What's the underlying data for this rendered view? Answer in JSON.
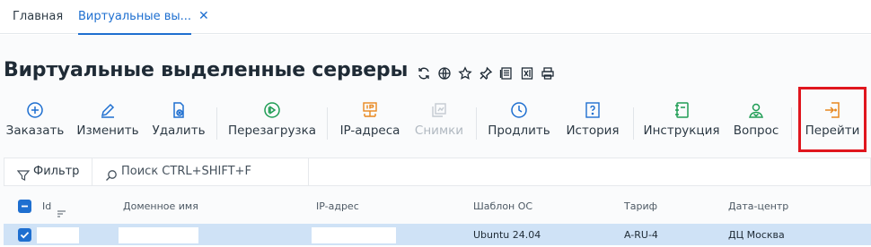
{
  "tabs": {
    "home": "Главная",
    "active": "Виртуальные вы...",
    "close": "✕"
  },
  "page": {
    "title": "Виртуальные выделенные серверы",
    "title_icons": [
      "refresh-icon",
      "globe-icon",
      "star-icon",
      "pin-icon",
      "document-icon",
      "excel-icon",
      "print-icon"
    ]
  },
  "toolbar": {
    "order": "Заказать",
    "edit": "Изменить",
    "delete": "Удалить",
    "reboot": "Перезагрузка",
    "ip": "IP-адреса",
    "snapshots": "Снимки",
    "renew": "Продлить",
    "history": "История",
    "instruction": "Инструкция",
    "question": "Вопрос",
    "goto": "Перейти"
  },
  "filter": {
    "label": "Фильтр",
    "search_placeholder": "Поиск CTRL+SHIFT+F"
  },
  "table": {
    "columns": [
      "Id",
      "Доменное имя",
      "IP-адрес",
      "Шаблон ОС",
      "Тариф",
      "Дата-центр"
    ],
    "rows": [
      {
        "id": "",
        "domain": "",
        "ip": "",
        "os": "Ubuntu 24.04",
        "tariff": "A-RU-4",
        "dc": "ДЦ Москва",
        "selected": true
      }
    ]
  },
  "colors": {
    "accent": "#1e6fd0",
    "green": "#1f9d55",
    "orange": "#e8871e",
    "highlight": "#e0161e",
    "selected_row": "#cfe2f6"
  }
}
